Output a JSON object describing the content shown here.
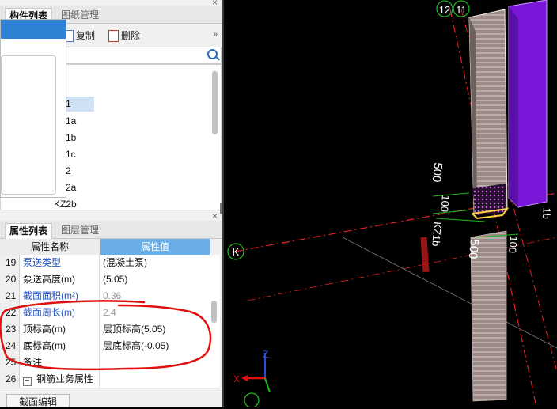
{
  "component_panel": {
    "tabs": [
      "构件列表",
      "图纸管理"
    ],
    "toolbar": {
      "copy": "复制",
      "delete": "删除",
      "more": "»"
    },
    "tree_items": [
      "1",
      "1a",
      "1b",
      "1c",
      "2",
      "2a",
      "KZ2b"
    ],
    "close": "×"
  },
  "property_panel": {
    "tabs": [
      "属性列表",
      "图层管理"
    ],
    "close": "×",
    "columns": [
      "属性名称",
      "属性值"
    ],
    "rows": [
      {
        "num": "19",
        "name": "泵送类型",
        "value": "(混凝土泵)",
        "name_style": "blue",
        "value_style": ""
      },
      {
        "num": "20",
        "name": "泵送高度(m)",
        "value": "(5.05)",
        "name_style": "",
        "value_style": ""
      },
      {
        "num": "21",
        "name": "截面面积(m²)",
        "value": "0.36",
        "name_style": "blue",
        "value_style": "gray"
      },
      {
        "num": "22",
        "name": "截面周长(m)",
        "value": "2.4",
        "name_style": "blue",
        "value_style": "gray"
      },
      {
        "num": "23",
        "name": "顶标高(m)",
        "value": "层顶标高(5.05)",
        "name_style": "",
        "value_style": ""
      },
      {
        "num": "24",
        "name": "底标高(m)",
        "value": "层底标高(-0.05)",
        "name_style": "",
        "value_style": ""
      },
      {
        "num": "25",
        "name": "备注",
        "value": "",
        "name_style": "",
        "value_style": ""
      },
      {
        "num": "26",
        "name": "钢筋业务属性",
        "value": "",
        "name_style": "",
        "value_style": ""
      }
    ],
    "bottom_tab": "截面编辑"
  },
  "viewport": {
    "axis_labels": {
      "top_a": "12",
      "top_b": "11",
      "left": "K"
    },
    "dims": {
      "d500_v": "500",
      "d100_v": "100",
      "d500_h": "500",
      "d100_h": "100"
    },
    "column_label": "KZ1b",
    "right_label": "1b",
    "gizmo": {
      "x": "X",
      "z": "Z"
    }
  },
  "colors": {
    "accent": "#2f83d6",
    "annotation": "#e01010",
    "axis_line": "#e02020",
    "grid_green": "#1db81d"
  }
}
